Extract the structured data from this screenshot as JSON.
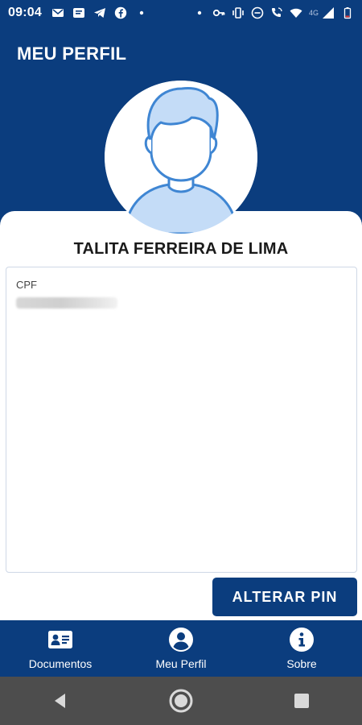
{
  "status_bar": {
    "time": "09:04",
    "network_label": "4G",
    "left_icons": [
      "mail-icon",
      "message-icon",
      "telegram-icon",
      "facebook-icon",
      "dot-icon"
    ],
    "right_icons": [
      "dot-icon",
      "key-icon",
      "vibrate-icon",
      "dnd-icon",
      "wifi-calling-icon",
      "wifi-icon",
      "signal-icon",
      "battery-icon"
    ]
  },
  "header": {
    "title": "MEU PERFIL"
  },
  "profile": {
    "avatar_icon": "user-avatar-icon",
    "name": "TALITA FERREIRA DE LIMA",
    "cpf_label": "CPF",
    "cpf_value": ""
  },
  "actions": {
    "change_pin_label": "ALTERAR PIN"
  },
  "bottom_nav": {
    "items": [
      {
        "label": "Documentos",
        "icon": "id-card-icon"
      },
      {
        "label": "Meu Perfil",
        "icon": "account-circle-icon"
      },
      {
        "label": "Sobre",
        "icon": "info-icon"
      }
    ]
  },
  "system_nav": {
    "buttons": [
      "back-icon",
      "home-icon",
      "recents-icon"
    ]
  },
  "colors": {
    "primary": "#0b3d7e",
    "avatar_light": "#c4dcf7",
    "avatar_stroke": "#3f86d3",
    "system_nav": "#4d4d4d"
  }
}
